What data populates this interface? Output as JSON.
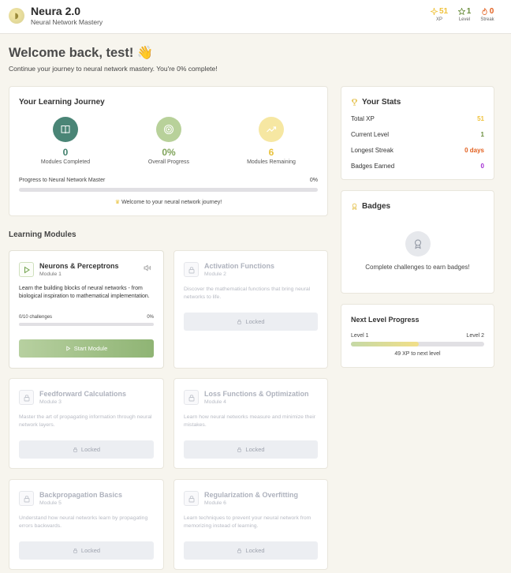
{
  "header": {
    "logo_glyph": "◗",
    "title": "Neura 2.0",
    "subtitle": "Neural Network Mastery",
    "stats": [
      {
        "value": "51",
        "label": "XP",
        "color": "#f0c23b",
        "icon": "sparkle-icon"
      },
      {
        "value": "1",
        "label": "Level",
        "color": "#6b8e3e",
        "icon": "star-icon"
      },
      {
        "value": "0",
        "label": "Streak",
        "color": "#e2601f",
        "icon": "flame-icon"
      }
    ]
  },
  "welcome": {
    "title": "Welcome back, test! 👋",
    "subtitle": "Continue your journey to neural network mastery. You're 0% complete!"
  },
  "journey": {
    "title": "Your Learning Journey",
    "items": [
      {
        "value": "0",
        "label": "Modules Completed",
        "color": "#3f7f6b",
        "bg": "#4a8576",
        "icon": "book-icon"
      },
      {
        "value": "0%",
        "label": "Overall Progress",
        "color": "#7fa35a",
        "bg": "#b8d19a",
        "icon": "target-icon"
      },
      {
        "value": "6",
        "label": "Modules Remaining",
        "color": "#e9c23c",
        "bg": "#f6e7a2",
        "icon": "trend-up-icon"
      }
    ],
    "progress_label": "Progress to Neural Network Master",
    "progress_value": "0%",
    "progress_fraction": 0,
    "message": "Welcome to your neural network journey!"
  },
  "modules_section_title": "Learning Modules",
  "modules": [
    {
      "title": "Neurons & Perceptrons",
      "number": "Module 1",
      "desc": "Learn the building blocks of neural networks - from biological inspiration to mathematical implementation.",
      "locked": false,
      "challenges": "0/10 challenges",
      "progress": "0%",
      "progress_fraction": 0,
      "button": "Start Module"
    },
    {
      "title": "Activation Functions",
      "number": "Module 2",
      "desc": "Discover the mathematical functions that bring neural networks to life.",
      "locked": true,
      "button": "Locked"
    },
    {
      "title": "Feedforward Calculations",
      "number": "Module 3",
      "desc": "Master the art of propagating information through neural network layers.",
      "locked": true,
      "button": "Locked"
    },
    {
      "title": "Loss Functions & Optimization",
      "number": "Module 4",
      "desc": "Learn how neural networks measure and minimize their mistakes.",
      "locked": true,
      "button": "Locked"
    },
    {
      "title": "Backpropagation Basics",
      "number": "Module 5",
      "desc": "Understand how neural networks learn by propagating errors backwards.",
      "locked": true,
      "button": "Locked"
    },
    {
      "title": "Regularization & Overfitting",
      "number": "Module 6",
      "desc": "Learn techniques to prevent your neural network from memorizing instead of learning.",
      "locked": true,
      "button": "Locked"
    }
  ],
  "stats": {
    "title": "Your Stats",
    "rows": [
      {
        "label": "Total XP",
        "value": "51",
        "color": "#f0c23b"
      },
      {
        "label": "Current Level",
        "value": "1",
        "color": "#6b8e3e"
      },
      {
        "label": "Longest Streak",
        "value": "0 days",
        "color": "#e2601f"
      },
      {
        "label": "Badges Earned",
        "value": "0",
        "color": "#a12ad1"
      }
    ]
  },
  "badges": {
    "title": "Badges",
    "empty_text": "Complete challenges to earn badges!"
  },
  "next_level": {
    "title": "Next Level Progress",
    "from_label": "Level 1",
    "to_label": "Level 2",
    "fraction": 0.51,
    "remaining_text": "49 XP to next level"
  }
}
